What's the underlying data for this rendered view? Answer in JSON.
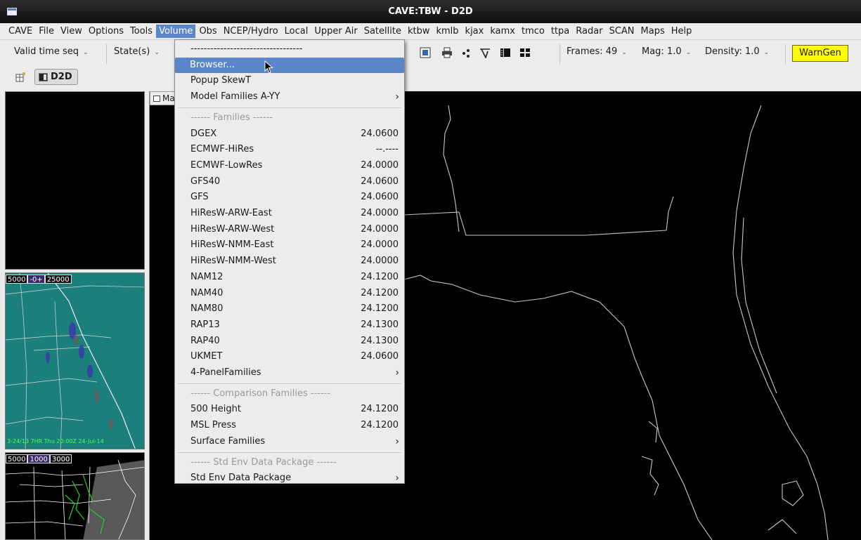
{
  "window": {
    "title": "CAVE:TBW - D2D"
  },
  "menubar": [
    "CAVE",
    "File",
    "View",
    "Options",
    "Tools",
    "Volume",
    "Obs",
    "NCEP/Hydro",
    "Local",
    "Upper Air",
    "Satellite",
    "ktbw",
    "kmlb",
    "kjax",
    "kamx",
    "tmco",
    "ttpa",
    "Radar",
    "SCAN",
    "Maps",
    "Help"
  ],
  "toolbar": {
    "valid_time": "Valid time seq",
    "state": "State(s)",
    "frames": "Frames: 49",
    "mag": "Mag: 1.0",
    "density": "Density: 1.0",
    "warngen": "WarnGen",
    "dropdown_arrow": "⌄"
  },
  "perspective_tab": {
    "label": "D2D"
  },
  "map_tab": {
    "label": "Ma"
  },
  "panes": {
    "p2": {
      "legend": [
        "5000",
        "-0+",
        "25000"
      ],
      "caption": "3-24/13 7HR Thu 20:00Z 24-Jul-14"
    },
    "p3": {
      "legend": [
        "5000",
        "1000",
        "3000"
      ]
    }
  },
  "menu": {
    "tearoff": "----------------------------------",
    "items": [
      {
        "label": "Browser...",
        "value": "",
        "submenu": false,
        "highlighted": true
      },
      {
        "label": "Popup SkewT",
        "value": "",
        "submenu": false
      },
      {
        "label": "Model Families A-YY",
        "value": "",
        "submenu": true
      }
    ],
    "families_header": "------ Families ------",
    "families": [
      {
        "label": "DGEX",
        "value": "24.0600"
      },
      {
        "label": "ECMWF-HiRes",
        "value": "--.----"
      },
      {
        "label": "ECMWF-LowRes",
        "value": "24.0000"
      },
      {
        "label": "GFS40",
        "value": "24.0600"
      },
      {
        "label": "GFS",
        "value": "24.0600"
      },
      {
        "label": "HiResW-ARW-East",
        "value": "24.0000"
      },
      {
        "label": "HiResW-ARW-West",
        "value": "24.0000"
      },
      {
        "label": "HiResW-NMM-East",
        "value": "24.0000"
      },
      {
        "label": "HiResW-NMM-West",
        "value": "24.0000"
      },
      {
        "label": "NAM12",
        "value": "24.1200"
      },
      {
        "label": "NAM40",
        "value": "24.1200"
      },
      {
        "label": "NAM80",
        "value": "24.1200"
      },
      {
        "label": "RAP13",
        "value": "24.1300"
      },
      {
        "label": "RAP40",
        "value": "24.1300"
      },
      {
        "label": "UKMET",
        "value": "24.0600"
      },
      {
        "label": "4-PanelFamilies",
        "value": "",
        "submenu": true
      }
    ],
    "comparison_header": "------ Comparison Families ------",
    "comparison": [
      {
        "label": "500 Height",
        "value": "24.1200"
      },
      {
        "label": "MSL Press",
        "value": "24.1200"
      },
      {
        "label": "Surface Families",
        "value": "",
        "submenu": true
      }
    ],
    "stdenv_header": "------ Std Env Data Package ------",
    "stdenv": [
      {
        "label": "Std Env Data Package",
        "value": "",
        "submenu": true
      }
    ],
    "submenu_arrow": "›"
  },
  "colors": {
    "highlight": "#5b86c9",
    "warngen": "#ffff00",
    "map_bg": "#000000",
    "coast": "#bdbdbd"
  }
}
